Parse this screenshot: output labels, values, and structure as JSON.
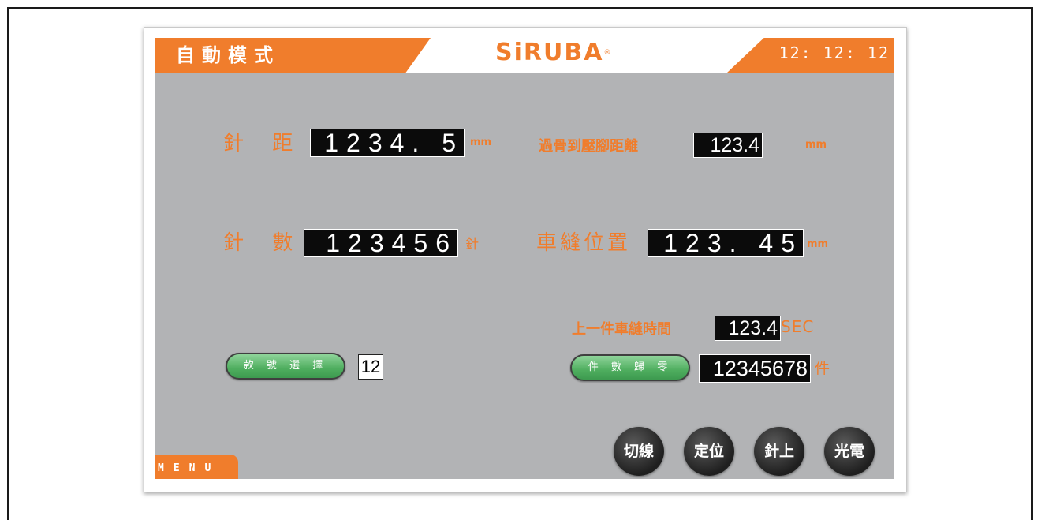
{
  "header": {
    "mode_title": "自動模式",
    "logo_text": "SiRUBA",
    "logo_mark": "®",
    "clock": "12: 12: 12"
  },
  "fields": {
    "stitch_length": {
      "label": "針 距",
      "value": "1234. 5",
      "unit": "mm"
    },
    "bone_to_foot": {
      "label": "過骨到壓腳距離",
      "value": "123.4",
      "unit": "mm"
    },
    "stitch_count": {
      "label": "針 數",
      "value": "123456",
      "unit": "針"
    },
    "sew_position": {
      "label": "車縫位置",
      "value": "123. 45",
      "unit": "mm"
    },
    "last_piece_time": {
      "label": "上一件車縫時間",
      "value": "123.4",
      "unit": "SEC"
    },
    "piece_count": {
      "value": "12345678",
      "unit": "件"
    }
  },
  "style_select": {
    "button_label": "款 號 選 擇",
    "value": "12"
  },
  "piece_reset": {
    "button_label": "件 數 歸 零"
  },
  "function_buttons": [
    "切線",
    "定位",
    "針上",
    "光電"
  ],
  "menu": {
    "label": "MENU"
  },
  "colors": {
    "accent": "#f07d2c",
    "panel": "#b2b3b5",
    "value_box": "#0b0b0b",
    "green_button": "#4fae5f"
  }
}
